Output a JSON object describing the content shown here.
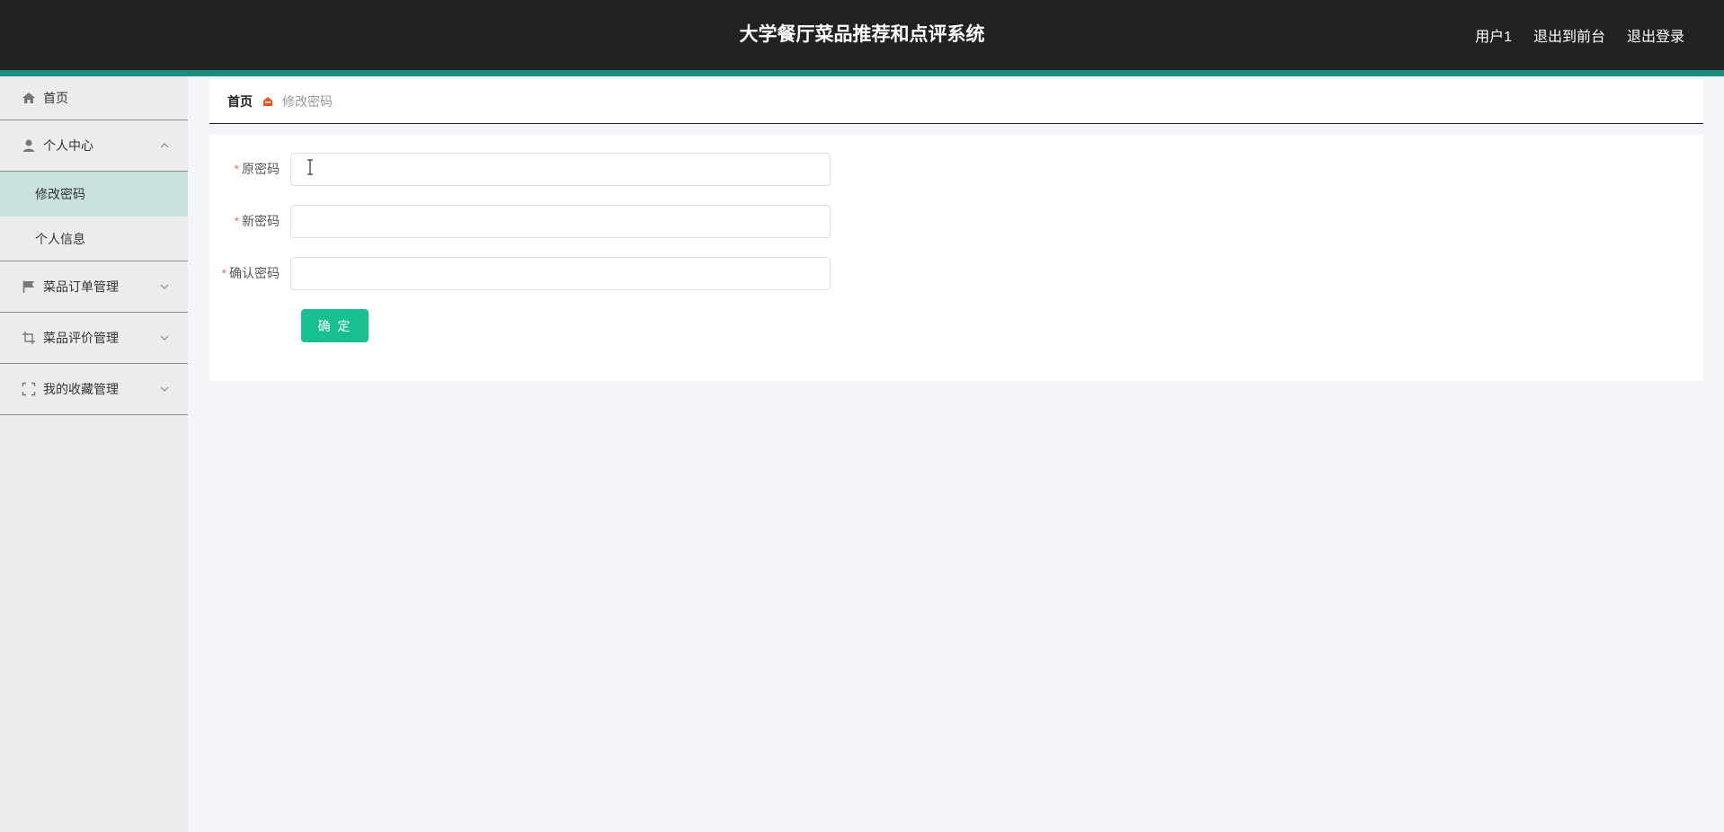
{
  "header": {
    "title": "大学餐厅菜品推荐和点评系统",
    "user": "用户1",
    "back_to_front": "退出到前台",
    "logout": "退出登录"
  },
  "sidebar": {
    "items": [
      {
        "label": "首页",
        "icon": "home-icon"
      },
      {
        "label": "个人中心",
        "icon": "user-icon",
        "expanded": true,
        "children": [
          {
            "label": "修改密码",
            "active": true
          },
          {
            "label": "个人信息"
          }
        ]
      },
      {
        "label": "菜品订单管理",
        "icon": "flag-icon"
      },
      {
        "label": "菜品评价管理",
        "icon": "crop-icon"
      },
      {
        "label": "我的收藏管理",
        "icon": "fullscreen-icon"
      }
    ]
  },
  "breadcrumb": {
    "home": "首页",
    "current": "修改密码"
  },
  "form": {
    "old_password": {
      "label": "原密码",
      "value": "",
      "placeholder": ""
    },
    "new_password": {
      "label": "新密码",
      "value": "",
      "placeholder": ""
    },
    "confirm_password": {
      "label": "确认密码",
      "value": "",
      "placeholder": ""
    },
    "submit_label": "确 定",
    "required_mark": "*"
  },
  "colors": {
    "header_bg": "#222222",
    "accent_stripe": "#1a8f7f",
    "primary_button": "#19c08f",
    "active_menu_bg": "#c9e1dc",
    "required": "#f56c6c"
  }
}
